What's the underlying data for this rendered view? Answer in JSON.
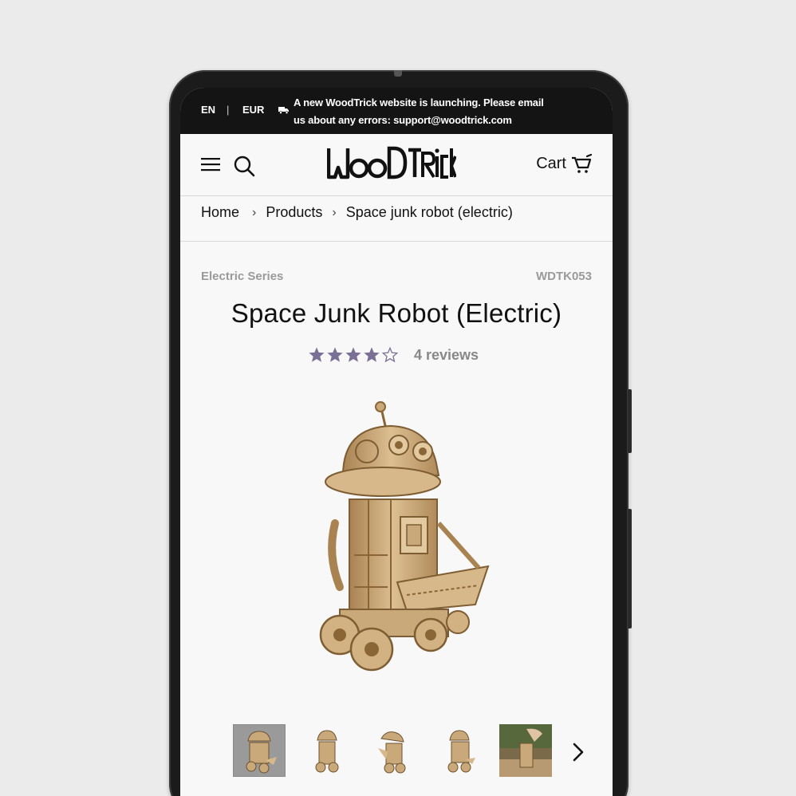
{
  "topbar": {
    "language": "EN",
    "separator": "|",
    "currency": "EUR",
    "announcement_line1": "A new WoodTrick website is launching. Please email",
    "announcement_line2": "us about any errors: support@woodtrick.com"
  },
  "header": {
    "logo_text": "WOODTRICK",
    "cart_label": "Cart"
  },
  "breadcrumb": {
    "items": [
      "Home",
      "Products",
      "Space junk robot (electric)"
    ],
    "separator": "›"
  },
  "product": {
    "series": "Electric Series",
    "sku": "WDTK053",
    "title": "Space Junk Robot (Electric)",
    "rating": 4,
    "rating_max": 5,
    "reviews_label": "4 reviews"
  },
  "gallery": {
    "thumbnail_count": 5,
    "selected_index": 0
  },
  "colors": {
    "topbar_bg": "#141414",
    "star_fill": "#7a6f95",
    "page_bg": "#f8f8f8",
    "wood": "#c9a879"
  },
  "icons": [
    "truck-icon",
    "menu-icon",
    "search-icon",
    "cart-icon",
    "star-icon",
    "chevron-right-icon"
  ]
}
